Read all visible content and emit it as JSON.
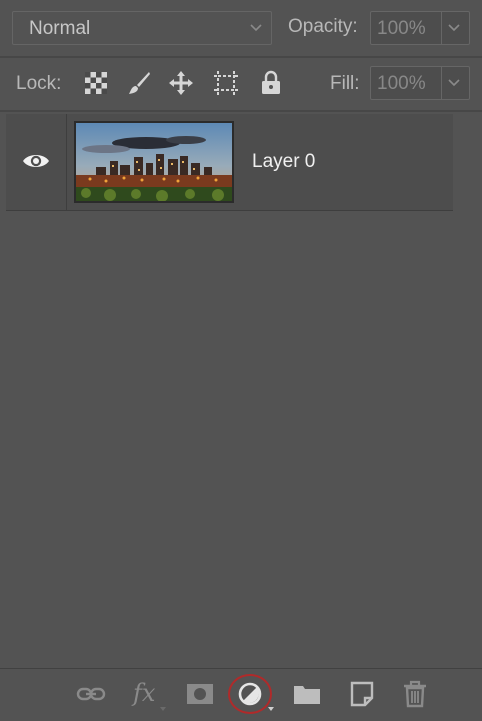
{
  "blend": {
    "mode": "Normal"
  },
  "opacity": {
    "label": "Opacity:",
    "value": "100%"
  },
  "lock": {
    "label": "Lock:"
  },
  "fill": {
    "label": "Fill:",
    "value": "100%"
  },
  "layer": {
    "name": "Layer 0",
    "visible": true
  },
  "icons": {
    "lock_transparent": "checkerboard-icon",
    "lock_image": "brush-icon",
    "lock_position": "move-icon",
    "lock_artboard": "artboard-icon",
    "lock_all": "padlock-icon",
    "link": "link-icon",
    "fx": "fx-icon",
    "mask": "mask-icon",
    "adjustment": "adjustment-icon",
    "group": "folder-icon",
    "new_layer": "new-layer-icon",
    "delete": "trash-icon"
  },
  "toolbar": {
    "fx_label": "fx"
  },
  "colors": {
    "panel_bg": "#535353",
    "highlight_ring": "#b02a2a"
  }
}
